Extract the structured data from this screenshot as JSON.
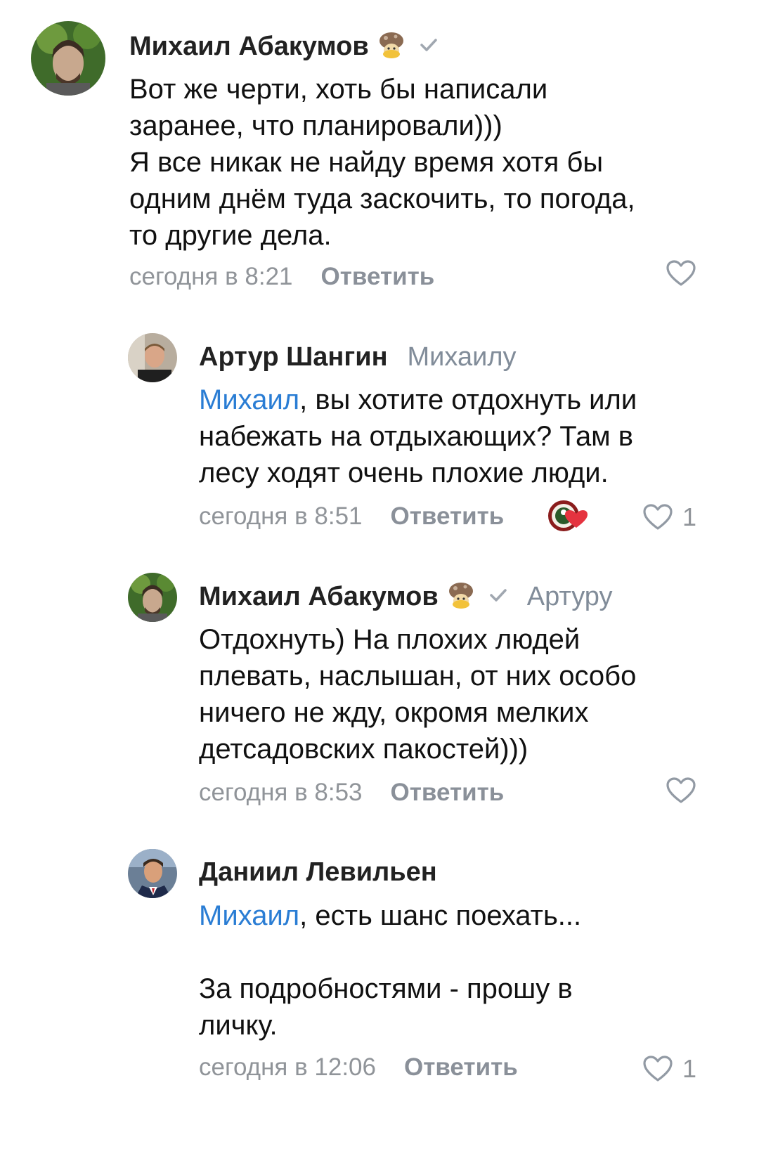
{
  "comments": [
    {
      "author": "Михаил Абакумов",
      "verified": true,
      "reply_to": "",
      "mention": "",
      "text": "Вот же черти, хоть бы написали\nзаранее, что планировали)))\nЯ все никак не найду время хотя бы\nодним днём туда заскочить, то погода,\nто другие дела.",
      "time": "сегодня в 8:21",
      "reply_label": "Ответить",
      "likes": ""
    },
    {
      "author": "Артур Шангин",
      "verified": false,
      "reply_to": "Михаилу",
      "mention": "Михаил",
      "text": ", вы хотите отдохнуть или\nнабежать на отдыхающих? Там в\nлесу ходят очень плохие люди.",
      "time": "сегодня в 8:51",
      "reply_label": "Ответить",
      "likes": "1"
    },
    {
      "author": "Михаил Абакумов",
      "verified": true,
      "reply_to": "Артуру",
      "mention": "",
      "text": "Отдохнуть) На плохих людей\nплевать, наслышан, от них особо\nничего не жду, окромя мелких\nдетсадовских пакостей)))",
      "time": "сегодня в 8:53",
      "reply_label": "Ответить",
      "likes": ""
    },
    {
      "author": "Даниил Левильен",
      "verified": false,
      "reply_to": "",
      "mention": "Михаил",
      "text": ", есть шанс поехать...\n\nЗа подробностями - прошу в\nличку.",
      "time": "сегодня в 12:06",
      "reply_label": "Ответить",
      "likes": "1"
    }
  ],
  "icons": {
    "heart": "heart-outline-icon",
    "verified": "checkmark-icon",
    "sticker_badge": "mushroom-sticker-icon",
    "reaction": "community-heart-reaction-icon"
  },
  "colors": {
    "mention": "#2a7dd4",
    "secondary": "#909499",
    "author": "#222222"
  }
}
